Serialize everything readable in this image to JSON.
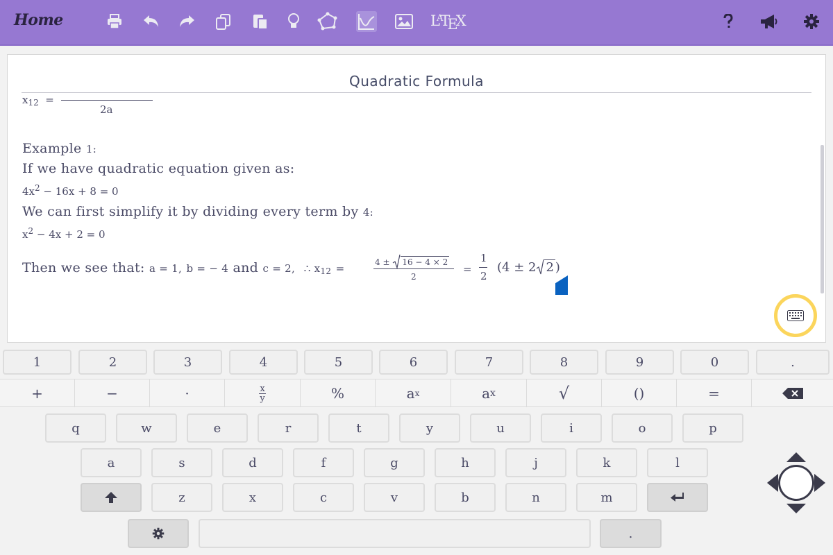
{
  "toolbar": {
    "home_label": "Home",
    "latex_label": {
      "l": "L",
      "a": "A",
      "t": "T",
      "e": "E",
      "x": "X"
    },
    "icons": [
      "print-icon",
      "undo-icon",
      "redo-icon",
      "copy-icon",
      "paste-icon",
      "lightbulb-icon",
      "polygon-icon",
      "graph-icon",
      "image-icon",
      "latex-icon",
      "help-icon",
      "megaphone-icon",
      "gear-icon"
    ]
  },
  "document": {
    "title": "Quadratic Formula",
    "formula": {
      "lhs": "x",
      "lhs_sub": "12",
      "eq": "=",
      "denominator": "2a"
    },
    "example_heading": "Example ",
    "example_num": "1:",
    "intro": "If we have quadratic equation given as:",
    "eq1": {
      "p1": "4x",
      "sup": "2",
      "p2": " − 16x + 8 = 0"
    },
    "simplify": "We can first simplify it by dividing every term by ",
    "simplify_num": "4:",
    "eq2": {
      "p1": "x",
      "sup": "2",
      "p2": " − 4x + 2 = 0"
    },
    "then": {
      "lead": "Then we see that: ",
      "a": "a = 1,",
      "b": "b = − 4",
      "and": " and ",
      "c": "c = 2,",
      "therefore": "∴ x",
      "sub": "12",
      "eq": "=",
      "num_pre": "4 ±",
      "num_rad": "16 − 4 × 2",
      "den": "2",
      "eq2": "=",
      "half_num": "1",
      "half_den": "2",
      "paren_pre": "(4 ± 2",
      "paren_rad": "2",
      "paren_post": ")"
    }
  },
  "keyboard": {
    "number_row": [
      "1",
      "2",
      "3",
      "4",
      "5",
      "6",
      "7",
      "8",
      "9",
      "0",
      "."
    ],
    "operator_row": {
      "plus": "+",
      "minus": "−",
      "dot": "·",
      "frac_num": "x",
      "frac_den": "y",
      "percent": "%",
      "power_base": "a",
      "power_exp": "x",
      "sub_base": "a",
      "sub_idx": "x",
      "sqrt": "√",
      "parens": "()",
      "equals": "="
    },
    "row_q": [
      "q",
      "w",
      "e",
      "r",
      "t",
      "y",
      "u",
      "i",
      "o",
      "p"
    ],
    "row_a": [
      "a",
      "s",
      "d",
      "f",
      "g",
      "h",
      "j",
      "k",
      "l"
    ],
    "row_z": [
      "z",
      "x",
      "c",
      "v",
      "b",
      "n",
      "m"
    ],
    "bottom_period": "."
  },
  "colors": {
    "toolbar": "#9678d2",
    "highlight": "#fbd55c",
    "cursor": "#0a62c0"
  }
}
